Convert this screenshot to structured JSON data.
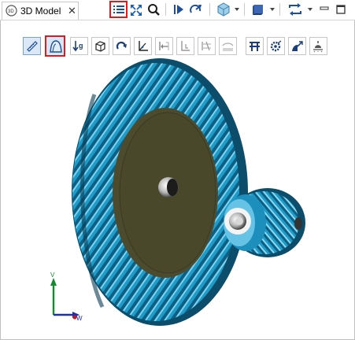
{
  "tab": {
    "title": "3D Model",
    "close_glyph": "✕",
    "icon": "3d-model-icon"
  },
  "toolbar": {
    "items": [
      "list-icon",
      "fit-all-icon",
      "zoom-icon",
      "play-icon",
      "rotate-animation-icon",
      "view-style-icon",
      "shading-icon",
      "swap-icon",
      "minimize-icon",
      "maximize-icon"
    ]
  },
  "viewer_toolbar": {
    "items": [
      "measure-icon",
      "profile-icon",
      "scale-icon",
      "box-icon",
      "rotate-icon",
      "axis-icon",
      "pull-icon",
      "l-icon",
      "gap-icon",
      "hatch-icon",
      "structure-icon",
      "gear-icon",
      "pointer-icon",
      "lamp-icon"
    ],
    "active": "profile-icon"
  },
  "triad": {
    "y_label": "V",
    "x_label": "W"
  },
  "colors": {
    "gear": "#1f9bc7",
    "gear_dark": "#0b4d6a",
    "hub": "#4d4b2e",
    "highlight": "#e01b1b"
  }
}
